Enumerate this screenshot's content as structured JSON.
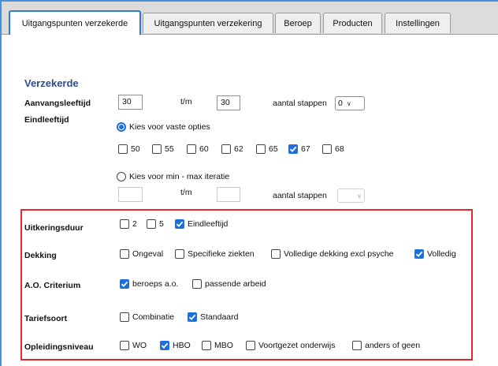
{
  "tabs": [
    {
      "label": "Uitgangspunten verzekerde",
      "active": true
    },
    {
      "label": "Uitgangspunten verzekering",
      "active": false
    },
    {
      "label": "Beroep",
      "active": false
    },
    {
      "label": "Producten",
      "active": false
    },
    {
      "label": "Instellingen",
      "active": false
    }
  ],
  "section_title": "Verzekerde",
  "aanvangsleeftijd": {
    "label": "Aanvangsleeftijd",
    "from": "30",
    "to_label": "t/m",
    "to": "30",
    "steps_label": "aantal stappen",
    "steps_value": "0"
  },
  "eindleeftijd": {
    "label": "Eindleeftijd",
    "option_fixed": {
      "label": "Kies voor vaste opties",
      "selected": true
    },
    "fixed_options": [
      {
        "label": "50",
        "checked": false
      },
      {
        "label": "55",
        "checked": false
      },
      {
        "label": "60",
        "checked": false
      },
      {
        "label": "62",
        "checked": false
      },
      {
        "label": "65",
        "checked": false
      },
      {
        "label": "67",
        "checked": true
      },
      {
        "label": "68",
        "checked": false
      }
    ],
    "option_range": {
      "label": "Kies voor min - max iteratie",
      "selected": false
    },
    "range_min": "",
    "range_to_label": "t/m",
    "range_max": "",
    "range_steps_label": "aantal stappen",
    "range_steps_value": ""
  },
  "uitkeringsduur": {
    "label": "Uitkeringsduur",
    "options": [
      {
        "label": "2",
        "checked": false
      },
      {
        "label": "5",
        "checked": false
      },
      {
        "label": "Eindleeftijd",
        "checked": true
      }
    ]
  },
  "dekking": {
    "label": "Dekking",
    "options": [
      {
        "label": "Ongeval",
        "checked": false
      },
      {
        "label": "Specifieke ziekten",
        "checked": false
      },
      {
        "label": "Volledige dekking excl psyche",
        "checked": false
      },
      {
        "label": "Volledig",
        "checked": true
      }
    ]
  },
  "ao_criterium": {
    "label": "A.O. Criterium",
    "options": [
      {
        "label": "beroeps a.o.",
        "checked": true
      },
      {
        "label": "passende arbeid",
        "checked": false
      }
    ]
  },
  "tariefsoort": {
    "label": "Tariefsoort",
    "options": [
      {
        "label": "Combinatie",
        "checked": false
      },
      {
        "label": "Standaard",
        "checked": true
      }
    ]
  },
  "opleidingsniveau": {
    "label": "Opleidingsniveau",
    "options": [
      {
        "label": "WO",
        "checked": false
      },
      {
        "label": "HBO",
        "checked": true
      },
      {
        "label": "MBO",
        "checked": false
      },
      {
        "label": "Voortgezet onderwijs",
        "checked": false
      },
      {
        "label": "anders of geen",
        "checked": false
      }
    ]
  },
  "colors": {
    "accent": "#1e6fd9",
    "highlight": "#e5282e",
    "title": "#2b4d8a"
  }
}
